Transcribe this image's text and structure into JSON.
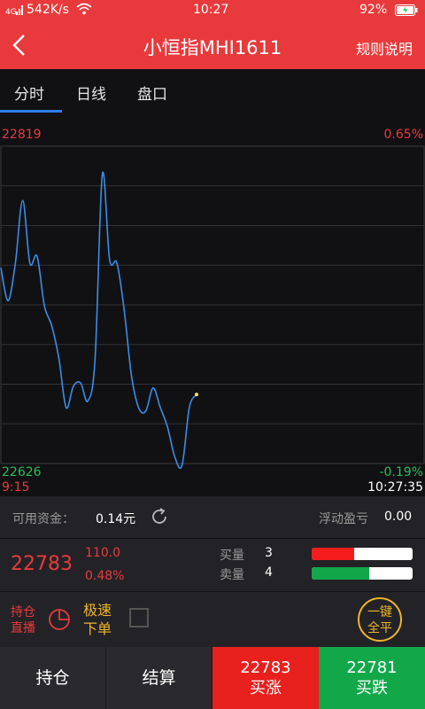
{
  "status_bar": {
    "speed": "542K/s",
    "time": "10:27",
    "battery": "92%"
  },
  "header": {
    "title": "小恒指MHI1611",
    "rules": "规则说明"
  },
  "tabs": [
    {
      "label": "分时",
      "active": true
    },
    {
      "label": "日线",
      "active": false
    },
    {
      "label": "盘口",
      "active": false
    }
  ],
  "chart_labels": {
    "top_price": "22819",
    "top_pct": "0.65%",
    "bottom_price": "22626",
    "bottom_pct": "-0.19%",
    "start_time": "9:15",
    "end_time": "10:27:35"
  },
  "chart_data": {
    "type": "line",
    "ylim": [
      22626,
      22819
    ],
    "grid": true,
    "series": [
      {
        "values": [
          22745,
          22725,
          22748,
          22786,
          22748,
          22752,
          22722,
          22710,
          22690,
          22660,
          22673,
          22675,
          22664,
          22690,
          22802,
          22750,
          22748,
          22720,
          22680,
          22660,
          22658,
          22672,
          22660,
          22648,
          22630,
          22625,
          22660,
          22668
        ]
      }
    ]
  },
  "funds": {
    "label": "可用资金：",
    "value": "0.14元",
    "float_label": "浮动盈亏",
    "float_value": "0.00"
  },
  "quote": {
    "price": "22783",
    "change": "110.0",
    "change_pct": "0.48%",
    "buy_label": "买量",
    "buy_qty": "3",
    "buy_level": 0.42,
    "sell_label": "卖量",
    "sell_qty": "4",
    "sell_level": 0.57,
    "buy_color": "#f41c1c",
    "sell_color": "#12a84a"
  },
  "options": {
    "hold_live_1": "持仓",
    "hold_live_2": "直播",
    "fast_1": "极速",
    "fast_2": "下单",
    "close_all_1": "一键",
    "close_all_2": "全平"
  },
  "bottom": {
    "positions": "持仓",
    "settle": "结算",
    "buy_up_price": "22783",
    "buy_up": "买涨",
    "buy_down_price": "22781",
    "buy_down": "买跌"
  },
  "colors": {
    "brand_red": "#e83a3c",
    "line_blue": "#3a8ee8",
    "gold": "#f0b429",
    "green": "#12a84a"
  }
}
